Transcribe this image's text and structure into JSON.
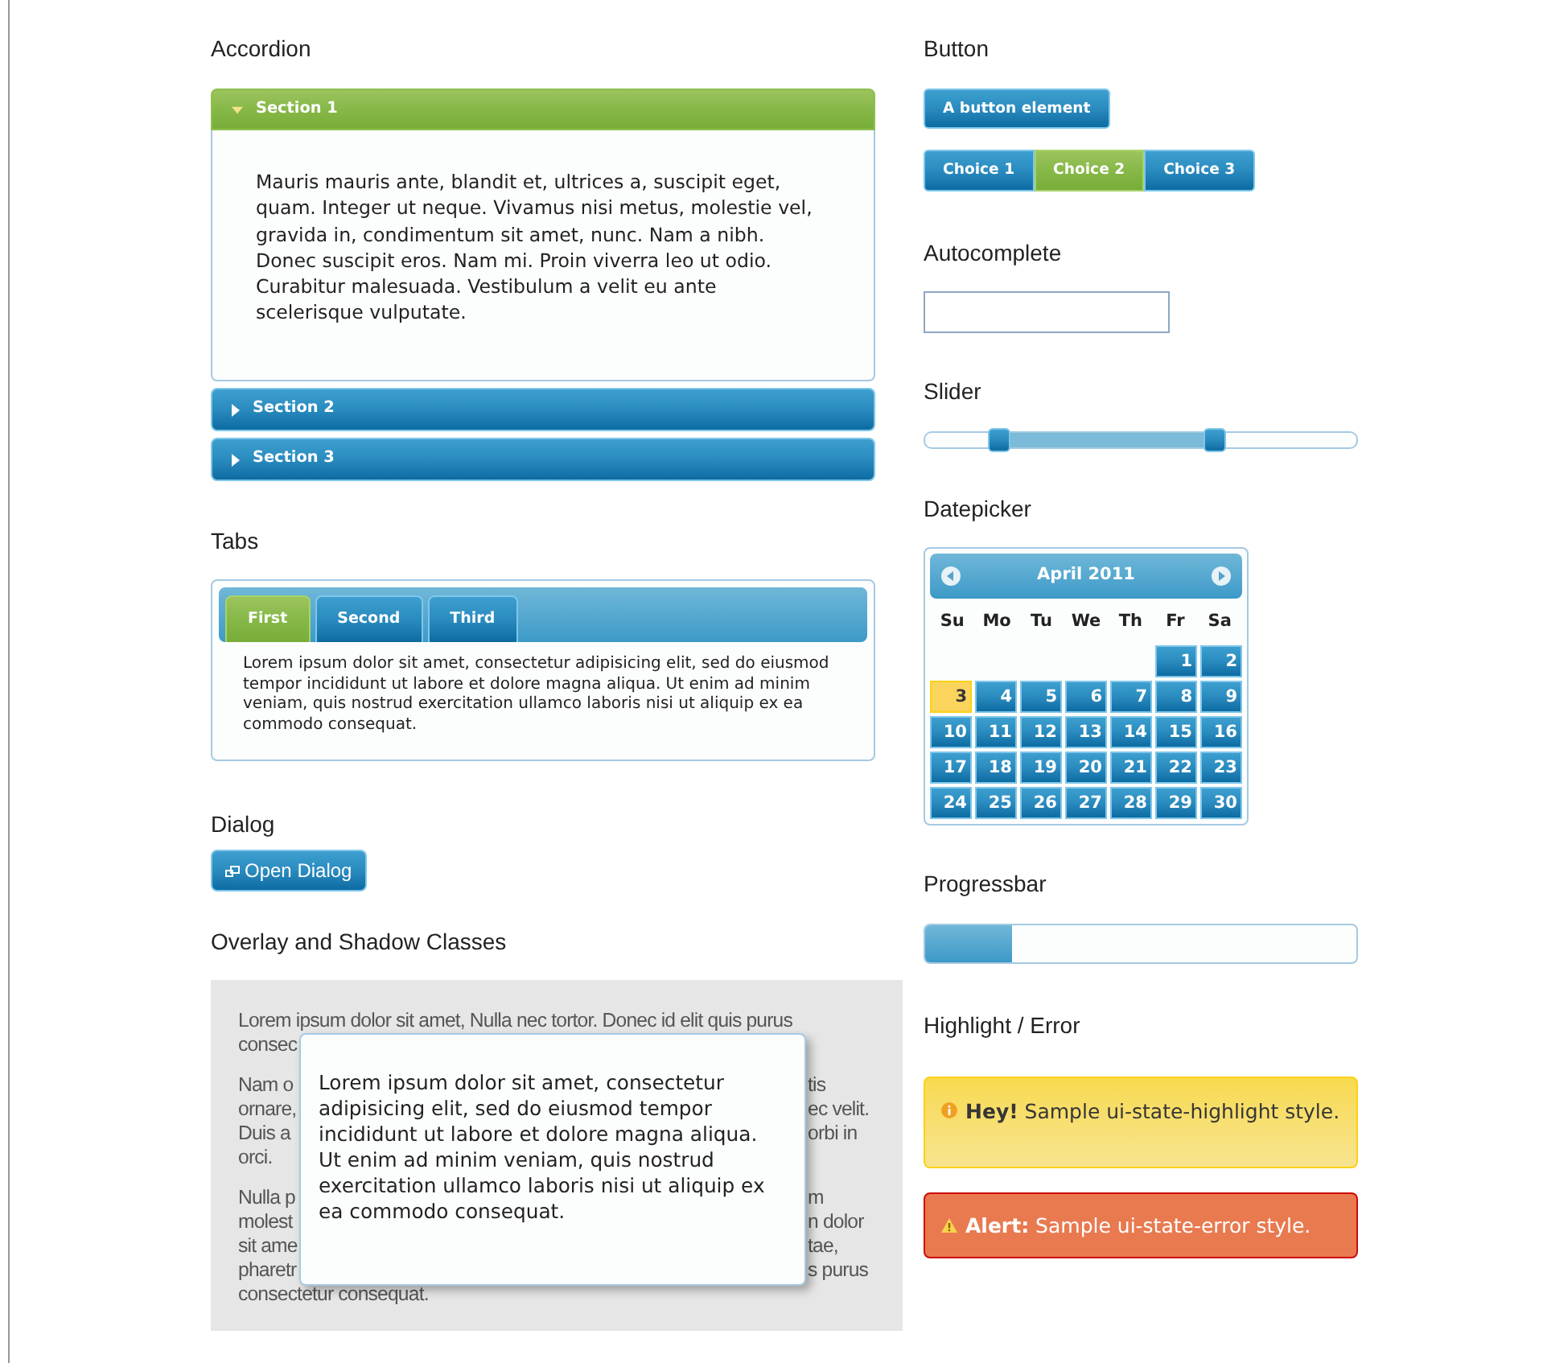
{
  "accordion": {
    "heading": "Accordion",
    "sections": [
      {
        "label": "Section 1",
        "expanded": true,
        "content": "Mauris mauris ante, blandit et, ultrices a, suscipit eget, quam. Integer ut neque. Vivamus nisi metus, molestie vel, gravida in, condimentum sit amet, nunc. Nam a nibh. Donec suscipit eros. Nam mi. Proin viverra leo ut odio. Curabitur malesuada. Vestibulum a velit eu ante scelerisque vulputate."
      },
      {
        "label": "Section 2",
        "expanded": false
      },
      {
        "label": "Section 3",
        "expanded": false
      }
    ]
  },
  "tabs": {
    "heading": "Tabs",
    "tabs": [
      {
        "label": "First",
        "selected": true
      },
      {
        "label": "Second",
        "selected": false
      },
      {
        "label": "Third",
        "selected": false
      }
    ],
    "panel_text": "Lorem ipsum dolor sit amet, consectetur adipisicing elit, sed do eiusmod tempor incididunt ut labore et dolore magna aliqua. Ut enim ad minim veniam, quis nostrud exercitation ullamco laboris nisi ut aliquip ex ea commodo consequat."
  },
  "dialog": {
    "heading": "Dialog",
    "button": "Open Dialog"
  },
  "overlay": {
    "heading": "Overlay and Shadow Classes",
    "background_paragraphs": [
      [
        {
          "left": "Lorem ipsum dolor sit amet, Nulla nec tortor. Donec id elit quis purus"
        },
        {
          "left": "consec"
        }
      ],
      [
        {
          "left": "Nam o",
          "right": "tis"
        },
        {
          "left": "ornare,",
          "right": "ec velit."
        },
        {
          "left": "Duis a",
          "right": "orbi in"
        },
        {
          "left": "orci."
        }
      ],
      [
        {
          "left": "Nulla p",
          "right": "m"
        },
        {
          "left": "molest",
          "right": "n dolor"
        },
        {
          "left": "sit ame",
          "right": "tae,"
        },
        {
          "left": "pharetr",
          "right": "s purus"
        },
        {
          "left": "consectetur consequat."
        }
      ]
    ],
    "dialog_text": "Lorem ipsum dolor sit amet, consectetur adipisicing elit, sed do eiusmod tempor incididunt ut labore et dolore magna aliqua. Ut enim ad minim veniam, quis nostrud exercitation ullamco laboris nisi ut aliquip ex ea commodo consequat."
  },
  "button": {
    "heading": "Button",
    "button": "A button element",
    "choices": [
      {
        "label": "Choice 1",
        "selected": false
      },
      {
        "label": "Choice 2",
        "selected": true
      },
      {
        "label": "Choice 3",
        "selected": false
      }
    ]
  },
  "autocomplete": {
    "heading": "Autocomplete"
  },
  "slider": {
    "heading": "Slider",
    "handles": [
      {
        "level": 0.17
      },
      {
        "level": 0.67
      }
    ]
  },
  "datepicker": {
    "heading": "Datepicker",
    "month": "April 2011",
    "weekdays": [
      "Su",
      "Mo",
      "Tu",
      "We",
      "Th",
      "Fr",
      "Sa"
    ],
    "weeks": [
      [
        {
          "kind": "blank"
        },
        {
          "kind": "blank"
        },
        {
          "kind": "blank"
        },
        {
          "kind": "blank"
        },
        {
          "kind": "blank"
        },
        {
          "kind": "day",
          "day": "1",
          "today": false
        },
        {
          "kind": "day",
          "day": "2",
          "today": false
        }
      ],
      [
        {
          "kind": "day",
          "day": "3",
          "today": true
        },
        {
          "kind": "day",
          "day": "4",
          "today": false
        },
        {
          "kind": "day",
          "day": "5",
          "today": false
        },
        {
          "kind": "day",
          "day": "6",
          "today": false
        },
        {
          "kind": "day",
          "day": "7",
          "today": false
        },
        {
          "kind": "day",
          "day": "8",
          "today": false
        },
        {
          "kind": "day",
          "day": "9",
          "today": false
        }
      ],
      [
        {
          "kind": "day",
          "day": "10",
          "today": false
        },
        {
          "kind": "day",
          "day": "11",
          "today": false
        },
        {
          "kind": "day",
          "day": "12",
          "today": false
        },
        {
          "kind": "day",
          "day": "13",
          "today": false
        },
        {
          "kind": "day",
          "day": "14",
          "today": false
        },
        {
          "kind": "day",
          "day": "15",
          "today": false
        },
        {
          "kind": "day",
          "day": "16",
          "today": false
        }
      ],
      [
        {
          "kind": "day",
          "day": "17",
          "today": false
        },
        {
          "kind": "day",
          "day": "18",
          "today": false
        },
        {
          "kind": "day",
          "day": "19",
          "today": false
        },
        {
          "kind": "day",
          "day": "20",
          "today": false
        },
        {
          "kind": "day",
          "day": "21",
          "today": false
        },
        {
          "kind": "day",
          "day": "22",
          "today": false
        },
        {
          "kind": "day",
          "day": "23",
          "today": false
        }
      ],
      [
        {
          "kind": "day",
          "day": "24",
          "today": false
        },
        {
          "kind": "day",
          "day": "25",
          "today": false
        },
        {
          "kind": "day",
          "day": "26",
          "today": false
        },
        {
          "kind": "day",
          "day": "27",
          "today": false
        },
        {
          "kind": "day",
          "day": "28",
          "today": false
        },
        {
          "kind": "day",
          "day": "29",
          "today": false
        },
        {
          "kind": "day",
          "day": "30",
          "today": false
        }
      ]
    ]
  },
  "progressbar": {
    "heading": "Progressbar",
    "level": 0.2
  },
  "messages": {
    "heading": "Highlight / Error",
    "items": [
      {
        "kind": "highlight",
        "text": "**Hey!** Sample ui-state-highlight style."
      },
      {
        "kind": "error",
        "text": "**Alert:** Sample ui-state-error style."
      }
    ]
  }
}
